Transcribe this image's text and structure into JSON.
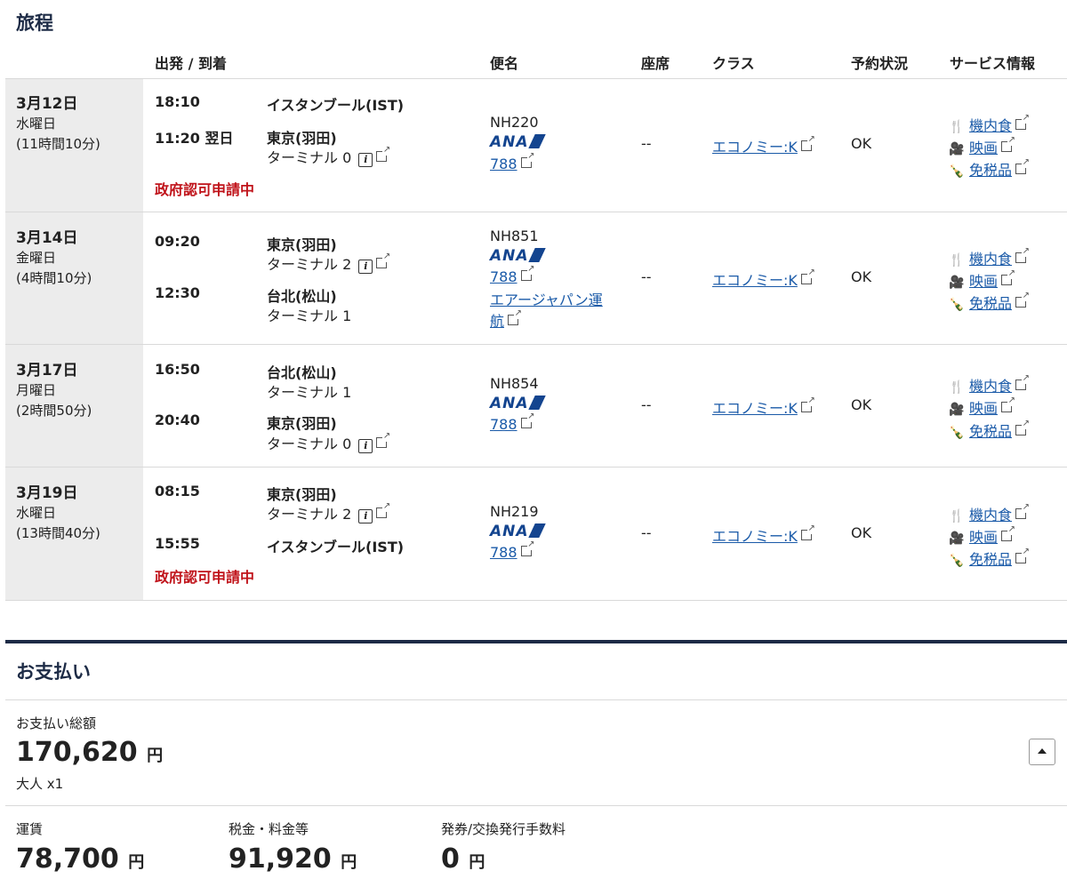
{
  "itinerary_title": "旅程",
  "headers": {
    "route": "出発 / 到着",
    "flight": "便名",
    "seat": "座席",
    "class": "クラス",
    "status": "予約状況",
    "service": "サービス情報"
  },
  "segments": [
    {
      "date": "3月12日",
      "weekday": "水曜日",
      "duration": "(11時間10分)",
      "dep_time": "18:10",
      "dep_city": "イスタンブール(IST)",
      "dep_terminal": "",
      "arr_time": "11:20 翌日",
      "arr_city": "東京(羽田)",
      "arr_terminal": "ターミナル 0",
      "note": "政府認可申請中",
      "flight_no": "NH220",
      "airline_logo": "ANA",
      "aircraft": "788",
      "operator": "",
      "seat": "--",
      "class_link": "エコノミー:K",
      "status": "OK"
    },
    {
      "date": "3月14日",
      "weekday": "金曜日",
      "duration": "(4時間10分)",
      "dep_time": "09:20",
      "dep_city": "東京(羽田)",
      "dep_terminal": "ターミナル 2",
      "arr_time": "12:30",
      "arr_city": "台北(松山)",
      "arr_terminal": "ターミナル 1",
      "note": "",
      "flight_no": "NH851",
      "airline_logo": "ANA",
      "aircraft": "788",
      "operator": "エアージャパン運航",
      "operator_line1": "エアージャパン運",
      "operator_line2": "航",
      "seat": "--",
      "class_link": "エコノミー:K",
      "status": "OK"
    },
    {
      "date": "3月17日",
      "weekday": "月曜日",
      "duration": "(2時間50分)",
      "dep_time": "16:50",
      "dep_city": "台北(松山)",
      "dep_terminal": "ターミナル 1",
      "arr_time": "20:40",
      "arr_city": "東京(羽田)",
      "arr_terminal": "ターミナル 0",
      "note": "",
      "flight_no": "NH854",
      "airline_logo": "ANA",
      "aircraft": "788",
      "operator": "",
      "seat": "--",
      "class_link": "エコノミー:K",
      "status": "OK"
    },
    {
      "date": "3月19日",
      "weekday": "水曜日",
      "duration": "(13時間40分)",
      "dep_time": "08:15",
      "dep_city": "東京(羽田)",
      "dep_terminal": "ターミナル 2",
      "arr_time": "15:55",
      "arr_city": "イスタンブール(IST)",
      "arr_terminal": "",
      "note": "政府認可申請中",
      "flight_no": "NH219",
      "airline_logo": "ANA",
      "aircraft": "788",
      "operator": "",
      "seat": "--",
      "class_link": "エコノミー:K",
      "status": "OK"
    }
  ],
  "services": {
    "meal": "機内食",
    "movie": "映画",
    "dutyfree": "免税品"
  },
  "payment": {
    "title": "お支払い",
    "total_label": "お支払い総額",
    "total_amount": "170,620",
    "currency": "円",
    "passengers": "大人 x1",
    "fare_label": "運賃",
    "fare_amount": "78,700",
    "tax_label": "税金・料金等",
    "tax_amount": "91,920",
    "fee_label": "発券/交換発行手数料",
    "fee_amount": "0"
  },
  "icons": {
    "info": "info-icon",
    "external": "external-link-icon",
    "meal": "fork-knife-icon",
    "movie": "film-camera-icon",
    "dutyfree": "bottle-icon",
    "collapse": "chevron-up-icon"
  },
  "colors": {
    "navy": "#1d2b46",
    "link": "#1a5aa8",
    "alert": "#c0141b",
    "ana_blue": "#13448f"
  }
}
